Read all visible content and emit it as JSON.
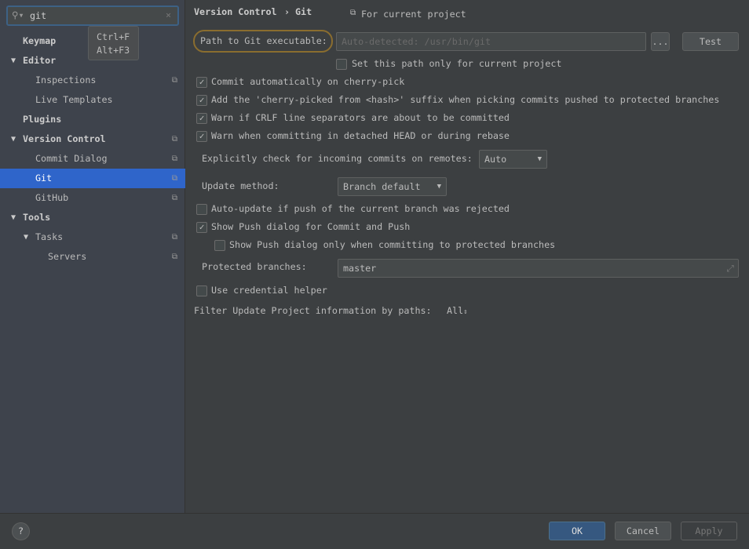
{
  "search": {
    "value": "git",
    "tooltip": [
      "Ctrl+F",
      "Alt+F3"
    ]
  },
  "tree": [
    {
      "label": "Keymap",
      "level": 0,
      "bold": true,
      "arrow": false,
      "copy": false
    },
    {
      "label": "Editor",
      "level": 0,
      "bold": true,
      "arrow": true,
      "copy": false
    },
    {
      "label": "Inspections",
      "level": 1,
      "copy": true
    },
    {
      "label": "Live Templates",
      "level": 1,
      "copy": false
    },
    {
      "label": "Plugins",
      "level": 0,
      "bold": true,
      "copy": false
    },
    {
      "label": "Version Control",
      "level": 0,
      "bold": true,
      "arrow": true,
      "copy": true
    },
    {
      "label": "Commit Dialog",
      "level": 1,
      "copy": true
    },
    {
      "label": "Git",
      "level": 1,
      "copy": true,
      "selected": true
    },
    {
      "label": "GitHub",
      "level": 1,
      "copy": true
    },
    {
      "label": "Tools",
      "level": 0,
      "bold": true,
      "arrow": true,
      "copy": false
    },
    {
      "label": "Tasks",
      "level": 1,
      "arrow": true,
      "copy": true
    },
    {
      "label": "Servers",
      "level": 2,
      "copy": true
    }
  ],
  "header": {
    "breadcrumb_parent": "Version Control",
    "separator": "›",
    "breadcrumb_current": "Git",
    "scope": "For current project"
  },
  "git_path": {
    "label": "Path to Git executable:",
    "placeholder": "Auto-detected: /usr/bin/git",
    "browse": "...",
    "test": "Test",
    "only_project": "Set this path only for current project"
  },
  "options": {
    "cherry_pick": {
      "label": "Commit automatically on cherry-pick",
      "checked": true
    },
    "cherry_suffix": {
      "label": "Add the 'cherry-picked from <hash>' suffix when picking commits pushed to protected branches",
      "checked": true
    },
    "crlf": {
      "label": "Warn if CRLF line separators are about to be committed",
      "checked": true
    },
    "detached": {
      "label": "Warn when committing in detached HEAD or during rebase",
      "checked": true
    },
    "incoming_label": "Explicitly check for incoming commits on remotes:",
    "incoming_value": "Auto",
    "update_label": "Update method:",
    "update_value": "Branch default",
    "auto_update": {
      "label": "Auto-update if push of the current branch was rejected",
      "checked": false
    },
    "show_push": {
      "label": "Show Push dialog for Commit and Push",
      "checked": true
    },
    "show_push_protected": {
      "label": "Show Push dialog only when committing to protected branches",
      "checked": false
    },
    "protected_label": "Protected branches:",
    "protected_value": "master",
    "credential": {
      "label": "Use credential helper",
      "checked": false
    },
    "filter_label": "Filter Update Project information by paths:",
    "filter_value": "All"
  },
  "footer": {
    "help": "?",
    "ok": "OK",
    "cancel": "Cancel",
    "apply": "Apply"
  }
}
